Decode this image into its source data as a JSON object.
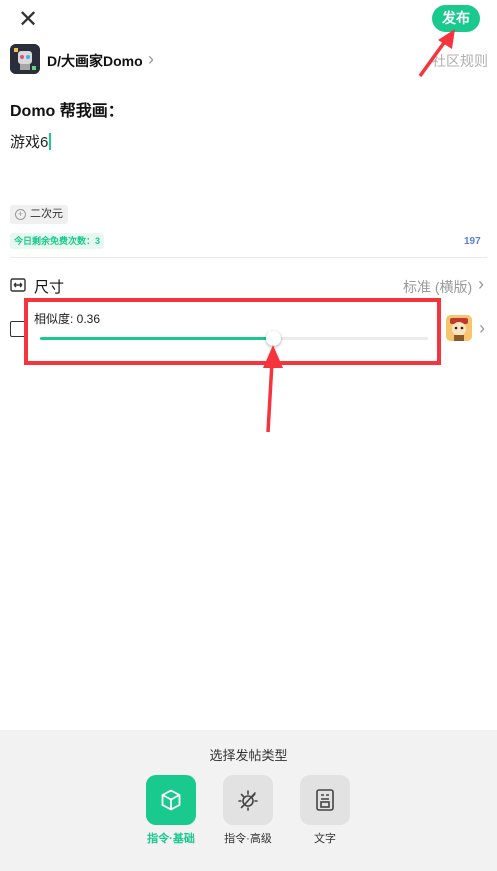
{
  "topbar": {
    "close_glyph": "✕",
    "publish_label": "发布"
  },
  "community": {
    "name": "D/大画家Domo",
    "chevron": "›",
    "rules_label": "社区规则"
  },
  "prompt": {
    "title": "Domo 帮我画：",
    "value": "游戏6",
    "tag_label": "二次元",
    "tag_icon": "plus-circle-icon",
    "remaining_label": "今日剩余免费次数：3",
    "char_counter": "197"
  },
  "size": {
    "label": "尺寸",
    "value": "标准 (横版)",
    "chevron": "›"
  },
  "similarity": {
    "label": "相似度: 0.36",
    "value": 0.36,
    "slider_fill_fraction": 0.6,
    "chevron": "›"
  },
  "post_types": {
    "title": "选择发帖类型",
    "items": [
      {
        "label": "指令·基础",
        "icon": "cube-icon",
        "active": true
      },
      {
        "label": "指令·高级",
        "icon": "sun-wand-icon",
        "active": false
      },
      {
        "label": "文字",
        "icon": "text-document-icon",
        "active": false
      }
    ]
  },
  "colors": {
    "accent": "#19c98e",
    "annotation": "#f5343d",
    "link_count": "#5b7fd8"
  }
}
